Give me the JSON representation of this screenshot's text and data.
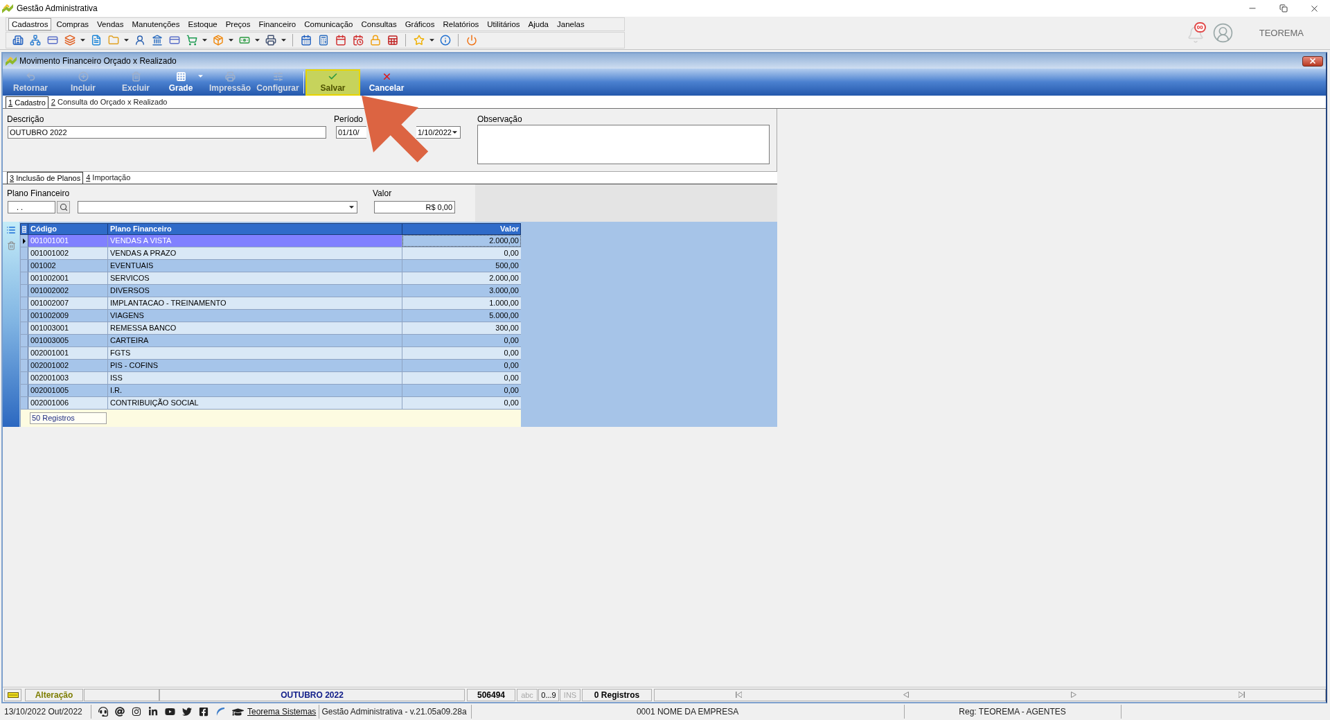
{
  "window": {
    "title": "Gestão Administrativa"
  },
  "menu": [
    {
      "label": "Cadastros",
      "selected": true
    },
    {
      "label": "Compras",
      "selected": false
    },
    {
      "label": "Vendas",
      "selected": false
    },
    {
      "label": "Manutenções",
      "selected": false
    },
    {
      "label": "Estoque",
      "selected": false
    },
    {
      "label": "Preços",
      "selected": false
    },
    {
      "label": "Financeiro",
      "selected": false
    },
    {
      "label": "Comunicação",
      "selected": false
    },
    {
      "label": "Consultas",
      "selected": false
    },
    {
      "label": "Gráficos",
      "selected": false
    },
    {
      "label": "Relatórios",
      "selected": false
    },
    {
      "label": "Utilitários",
      "selected": false
    },
    {
      "label": "Ajuda",
      "selected": false
    },
    {
      "label": "Janelas",
      "selected": false
    }
  ],
  "user_area": {
    "notification_count": "00",
    "user_name": "TEOREMA"
  },
  "child_window": {
    "title": "Movimento Financeiro Orçado x Realizado",
    "toolbar": [
      {
        "label": "Retornar",
        "disabled": true,
        "dropdown": false,
        "highlighted": false
      },
      {
        "label": "Incluir",
        "disabled": true,
        "dropdown": false,
        "highlighted": false
      },
      {
        "label": "Excluir",
        "disabled": true,
        "dropdown": false,
        "highlighted": false
      },
      {
        "label": "Grade",
        "disabled": false,
        "dropdown": true,
        "highlighted": false
      },
      {
        "label": "Impressão",
        "disabled": true,
        "dropdown": false,
        "highlighted": false
      },
      {
        "label": "Configurar",
        "disabled": true,
        "dropdown": false,
        "highlighted": false
      },
      {
        "label": "Salvar",
        "disabled": false,
        "dropdown": false,
        "highlighted": true
      },
      {
        "label": "Cancelar",
        "disabled": false,
        "dropdown": false,
        "highlighted": false
      }
    ],
    "tabs": [
      {
        "label": "1 Cadastro",
        "selected": true
      },
      {
        "label": "2 Consulta do Orçado x Realizado",
        "selected": false
      }
    ],
    "form": {
      "description": {
        "label": "Descrição",
        "value": "OUTUBRO 2022"
      },
      "period": {
        "label": "Período",
        "start": "01/10/",
        "end": "1/10/2022"
      },
      "notes": {
        "label": "Observação"
      }
    },
    "subtabs": [
      {
        "label": "3 Inclusão de Planos",
        "selected": true
      },
      {
        "label": "4 Importação",
        "selected": false
      }
    ],
    "entry": {
      "plan": {
        "label": "Plano Financeiro",
        "code": ". ."
      },
      "amount": {
        "label": "Valor",
        "value": "R$ 0,00"
      }
    },
    "table": {
      "columns": [
        "Código",
        "Plano Financeiro",
        "Valor"
      ],
      "rows": [
        {
          "code": "001001001",
          "plan": "VENDAS A VISTA",
          "value": "2.000,00",
          "selected": true
        },
        {
          "code": "001001002",
          "plan": "VENDAS A PRAZO",
          "value": "0,00",
          "selected": false
        },
        {
          "code": "001002",
          "plan": "EVENTUAIS",
          "value": "500,00",
          "selected": false
        },
        {
          "code": "001002001",
          "plan": "SERVICOS",
          "value": "2.000,00",
          "selected": false
        },
        {
          "code": "001002002",
          "plan": "DIVERSOS",
          "value": "3.000,00",
          "selected": false
        },
        {
          "code": "001002007",
          "plan": "IMPLANTACAO - TREINAMENTO",
          "value": "1.000,00",
          "selected": false
        },
        {
          "code": "001002009",
          "plan": "VIAGENS",
          "value": "5.000,00",
          "selected": false
        },
        {
          "code": "001003001",
          "plan": "REMESSA BANCO",
          "value": "300,00",
          "selected": false
        },
        {
          "code": "001003005",
          "plan": "CARTEIRA",
          "value": "0,00",
          "selected": false
        },
        {
          "code": "002001001",
          "plan": "FGTS",
          "value": "0,00",
          "selected": false
        },
        {
          "code": "002001002",
          "plan": "PIS - COFINS",
          "value": "0,00",
          "selected": false
        },
        {
          "code": "002001003",
          "plan": "ISS",
          "value": "0,00",
          "selected": false
        },
        {
          "code": "002001005",
          "plan": "I.R.",
          "value": "0,00",
          "selected": false
        },
        {
          "code": "002001006",
          "plan": "CONTRIBUIÇÃO SOCIAL",
          "value": "0,00",
          "selected": false
        }
      ],
      "footer": "50 Registros"
    },
    "status_bar": {
      "mode": "Alteração",
      "description": "OUTUBRO 2022",
      "code": "506494",
      "indicators": [
        {
          "label": "abc",
          "active": false
        },
        {
          "label": "0...9",
          "active": true
        },
        {
          "label": "INS",
          "active": false
        }
      ],
      "records": "0 Registros"
    }
  },
  "status_bar": {
    "date": "13/10/2022 Out/2022",
    "link": "Teorema Sistemas",
    "version": "Gestão Administrativa - v.21.05a09.28a",
    "company": "0001 NOME DA EMPRESA",
    "registration": "Reg: TEOREMA - AGENTES"
  }
}
